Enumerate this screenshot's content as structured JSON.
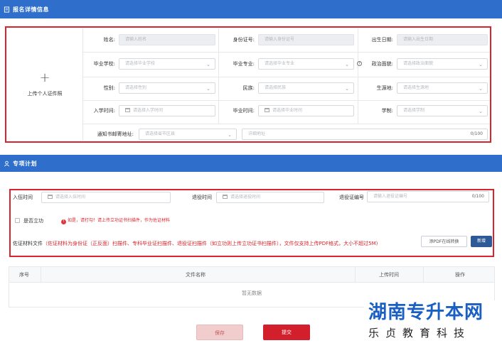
{
  "section1": {
    "title": "报名详情信息"
  },
  "upload": {
    "label": "上传个人证件照"
  },
  "fields": {
    "name": {
      "label": "姓名:",
      "placeholder": "请输入姓名"
    },
    "idcard": {
      "label": "身份证号:",
      "placeholder": "请输入身份证号"
    },
    "birth": {
      "label": "出生日期:",
      "placeholder": "请输入出生日期"
    },
    "school": {
      "label": "毕业学校:",
      "placeholder": "请选择毕业学校"
    },
    "major": {
      "label": "毕业专业:",
      "placeholder": "请选择毕业专业"
    },
    "politics": {
      "label": "政治面貌:",
      "placeholder": "请选择政治面貌"
    },
    "gender": {
      "label": "性别:",
      "placeholder": "请选择性别"
    },
    "ethnic": {
      "label": "民族:",
      "placeholder": "请选择民族"
    },
    "origin": {
      "label": "生源地:",
      "placeholder": "请选择生源地"
    },
    "enroll": {
      "label": "入学时间:",
      "placeholder": "请选择入学时间"
    },
    "grad": {
      "label": "毕业时间:",
      "placeholder": "请选择毕业时间"
    },
    "system": {
      "label": "学制:",
      "placeholder": "请选择学制"
    },
    "mailing": {
      "label": "通知书邮寄地址:",
      "placeholder": "请选择省市区县",
      "detail_placeholder": "详细地址",
      "count": "0/100"
    }
  },
  "section2": {
    "title": "专项计划"
  },
  "plan": {
    "enlist": {
      "label": "入伍时间",
      "placeholder": "请选择入伍时间"
    },
    "discharge": {
      "label": "退役时间",
      "placeholder": "请选择退役时间"
    },
    "cert": {
      "label": "退役证编号",
      "placeholder": "请输入退役证编号",
      "count": "0/100"
    },
    "merit": {
      "label": "是否立功",
      "warning": "如是，请打勾！请上传立功证书扫描件，作为佐证材料"
    },
    "evidence": {
      "label": "佐证材料文件",
      "note": "（佐证材料为身份证（正反面）扫描件、专科毕业证扫描件、退役证扫描件（如立功则上传立功证书扫描件），文件仅支持上传PDF格式，大小不超过5M)"
    },
    "pdf_button": "添PDF在线转换",
    "add_button": "新增"
  },
  "table": {
    "columns": [
      "序号",
      "文件名称",
      "上传时间",
      "操作"
    ],
    "empty": "暂无数据"
  },
  "actions": {
    "save": "保存",
    "submit": "提交"
  },
  "watermark": {
    "line1": "湖南专升本网",
    "line2": "乐贞教育科技"
  }
}
